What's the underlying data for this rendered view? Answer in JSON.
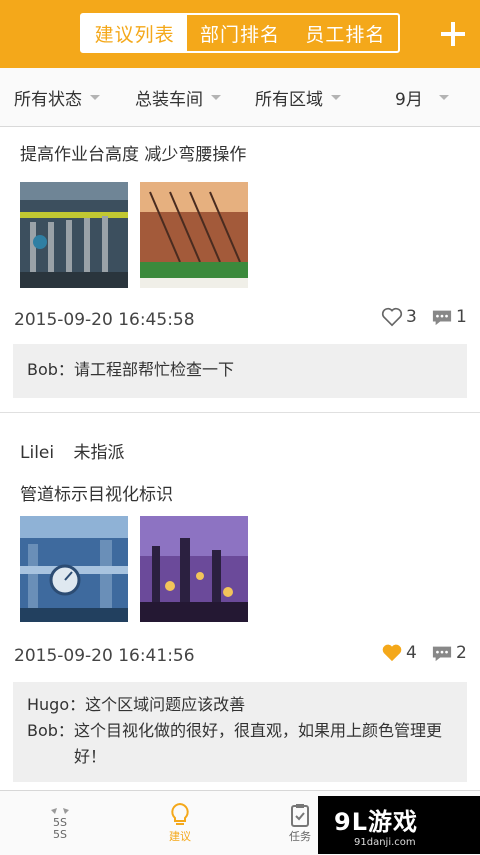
{
  "header": {
    "tabs": [
      {
        "label": "建议列表",
        "active": true
      },
      {
        "label": "部门排名",
        "active": false
      },
      {
        "label": "员工排名",
        "active": false
      }
    ],
    "add_icon": "plus-icon",
    "accent_color": "#f4a81a"
  },
  "filters": [
    {
      "label": "所有状态"
    },
    {
      "label": "总装车间"
    },
    {
      "label": "所有区域"
    },
    {
      "label": "9月"
    }
  ],
  "posts": [
    {
      "author": "",
      "status": "",
      "title": "提高作业台高度 减少弯腰操作",
      "time": "2015-09-20 16:45:58",
      "likes": "3",
      "liked": false,
      "comment_count": "1",
      "comments": [
        {
          "name": "Bob：",
          "text": "请工程部帮忙检查一下"
        }
      ]
    },
    {
      "author": "Lilei",
      "status": "未指派",
      "title": "管道标示目视化标识",
      "time": "2015-09-20 16:41:56",
      "likes": "4",
      "liked": true,
      "comment_count": "2",
      "comments": [
        {
          "name": "Hugo：",
          "text": "这个区域问题应该改善"
        },
        {
          "name": "Bob：",
          "text": "这个目视化做的很好，很直观，如果用上颜色管理更好！"
        }
      ]
    }
  ],
  "bottom_nav": [
    {
      "label": "5S",
      "icon": "5s-icon",
      "active": false
    },
    {
      "label": "建议",
      "icon": "lightbulb-icon",
      "active": true
    },
    {
      "label": "任务",
      "icon": "clipboard-icon",
      "active": false
    }
  ],
  "watermark": {
    "main": "9L游戏",
    "sub": "91danji.com"
  }
}
